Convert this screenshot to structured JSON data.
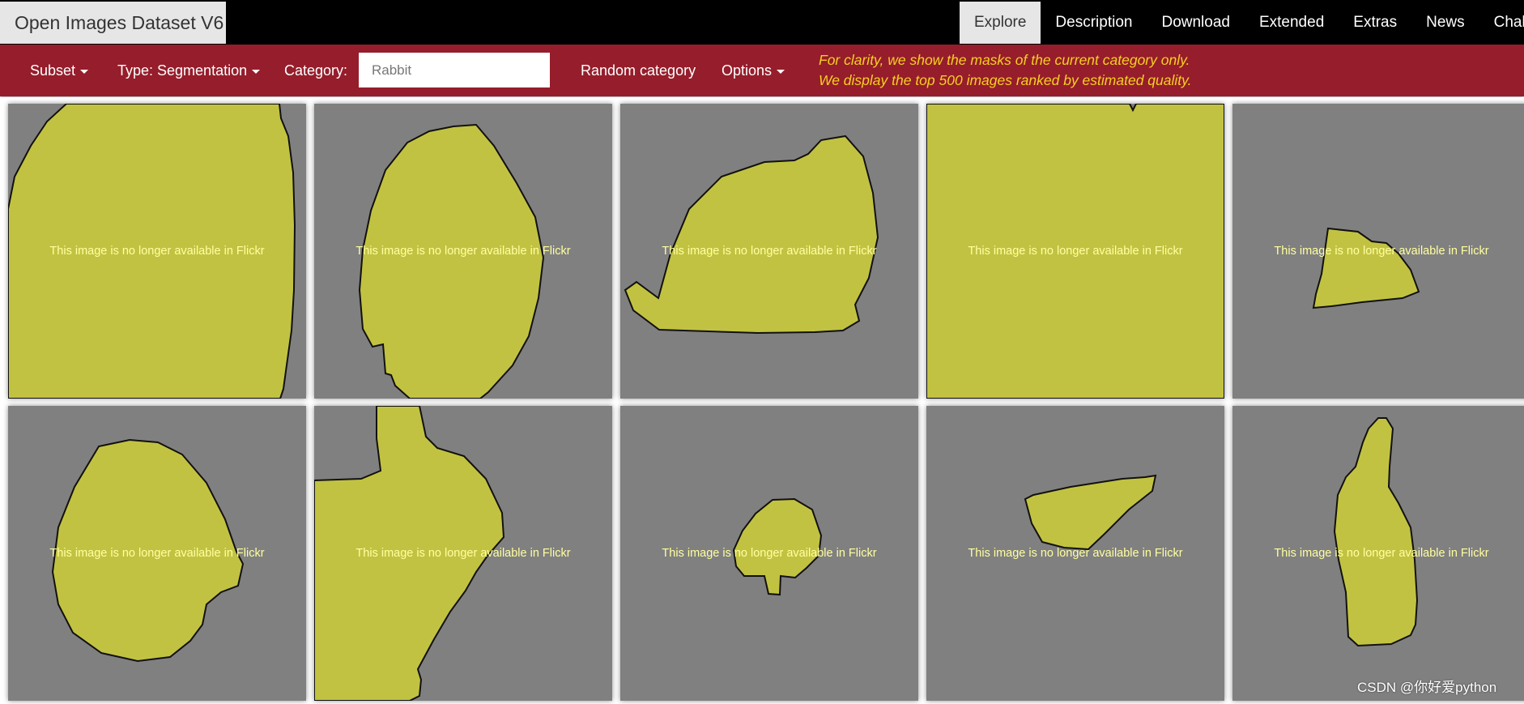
{
  "brand": "Open Images Dataset V6",
  "nav": [
    {
      "label": "Explore"
    },
    {
      "label": "Description"
    },
    {
      "label": "Download"
    },
    {
      "label": "Extended"
    },
    {
      "label": "Extras"
    },
    {
      "label": "News"
    },
    {
      "label": "Challen"
    }
  ],
  "toolbar": {
    "subset_label": "Subset",
    "type_label": "Type: Segmentation",
    "category_label": "Category:",
    "category_placeholder": "Rabbit",
    "random_label": "Random category",
    "options_label": "Options",
    "notice_line1": "For clarity, we show the masks of the current category only.",
    "notice_line2": "We display the top 500 images ranked by estimated quality."
  },
  "tile_caption": "This image is no longer available in Flickr",
  "mask_color": "#c2c242",
  "tile_bg_color": "#808080",
  "watermark": "CSDN @你好爱python"
}
